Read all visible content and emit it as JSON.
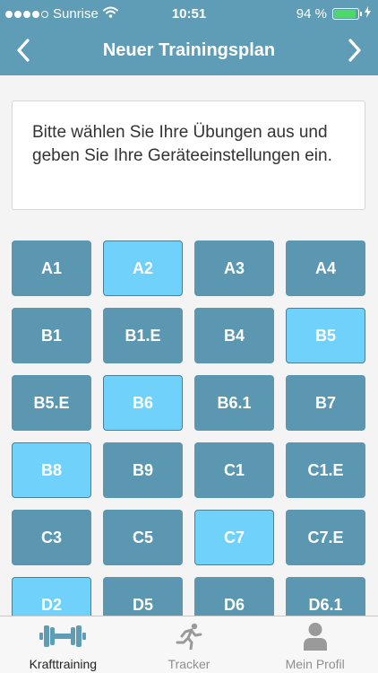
{
  "status_bar": {
    "carrier": "Sunrise",
    "time": "10:51",
    "battery_text": "94 %",
    "battery_level": 0.94,
    "signal_bars": 4
  },
  "nav_bar": {
    "title": "Neuer Trainingsplan",
    "back_icon": "chevron-left-icon",
    "forward_icon": "chevron-right-icon"
  },
  "info": {
    "text": "Bitte wählen Sie Ihre Übungen aus und geben Sie Ihre Geräteeinstellungen ein."
  },
  "exercises": [
    {
      "label": "A1",
      "selected": false
    },
    {
      "label": "A2",
      "selected": true
    },
    {
      "label": "A3",
      "selected": false
    },
    {
      "label": "A4",
      "selected": false
    },
    {
      "label": "B1",
      "selected": false
    },
    {
      "label": "B1.E",
      "selected": false
    },
    {
      "label": "B4",
      "selected": false
    },
    {
      "label": "B5",
      "selected": true
    },
    {
      "label": "B5.E",
      "selected": false
    },
    {
      "label": "B6",
      "selected": true
    },
    {
      "label": "B6.1",
      "selected": false
    },
    {
      "label": "B7",
      "selected": false
    },
    {
      "label": "B8",
      "selected": true
    },
    {
      "label": "B9",
      "selected": false
    },
    {
      "label": "C1",
      "selected": false
    },
    {
      "label": "C1.E",
      "selected": false
    },
    {
      "label": "C3",
      "selected": false
    },
    {
      "label": "C5",
      "selected": false
    },
    {
      "label": "C7",
      "selected": true
    },
    {
      "label": "C7.E",
      "selected": false
    },
    {
      "label": "D2",
      "selected": true
    },
    {
      "label": "D5",
      "selected": false
    },
    {
      "label": "D6",
      "selected": false
    },
    {
      "label": "D6.1",
      "selected": false
    }
  ],
  "tab_bar": {
    "tabs": [
      {
        "label": "Krafttraining",
        "icon": "dumbbell-icon",
        "active": true
      },
      {
        "label": "Tracker",
        "icon": "runner-icon",
        "active": false
      },
      {
        "label": "Mein Profil",
        "icon": "person-icon",
        "active": false
      }
    ]
  },
  "colors": {
    "primary": "#5e9db5",
    "tile": "#5b97b0",
    "tile_selected": "#70d2fb",
    "battery": "#4cd964"
  }
}
